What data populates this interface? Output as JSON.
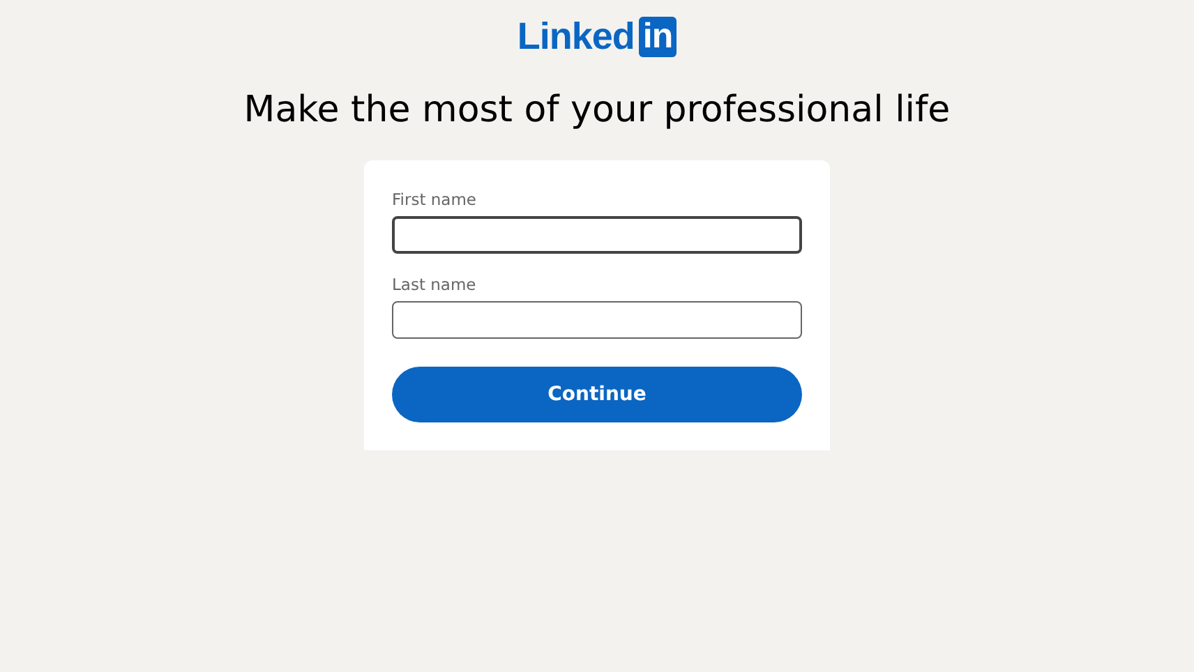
{
  "logo": {
    "text": "Linked",
    "badge": "in"
  },
  "heading": "Make the most of your professional life",
  "fields": [
    {
      "label": "First name",
      "focused": true
    },
    {
      "label": "Last name",
      "focused": false
    }
  ],
  "button": "Continue"
}
